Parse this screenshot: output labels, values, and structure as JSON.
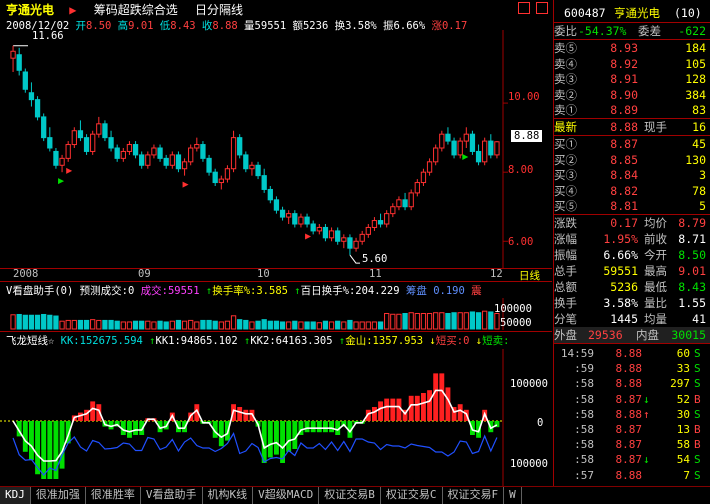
{
  "header": {
    "stock_name": "亨通光电",
    "menu": [
      "筹码超跌综合选",
      "日分隔线"
    ],
    "top_arrow": "▶"
  },
  "infoline": {
    "date": "2008/12/02",
    "open_label": "开",
    "open": "8.50",
    "high_label": "高",
    "high": "9.01",
    "low_label": "低",
    "low": "8.43",
    "close_label": "收",
    "close": "8.88",
    "vol_label": "量",
    "vol": "59551",
    "amt_label": "额",
    "amt": "5236",
    "turn_label": "换",
    "turn": "3.58%",
    "amp_label": "振",
    "amp": "6.66%",
    "chg_label": "涨",
    "chg": "0.17"
  },
  "price_chart": {
    "high_mark": "11.66",
    "low_mark": "5.60",
    "yticks": [
      "10.00",
      "8.00",
      "6.00"
    ],
    "current_price_tag": "8.88",
    "candles": [
      [
        11.3,
        11.66,
        10.9,
        11.5
      ],
      [
        11.4,
        11.6,
        10.8,
        10.95
      ],
      [
        10.9,
        11.0,
        10.3,
        10.4
      ],
      [
        10.3,
        10.6,
        9.9,
        10.1
      ],
      [
        10.1,
        10.2,
        9.5,
        9.6
      ],
      [
        9.6,
        9.7,
        8.9,
        9.0
      ],
      [
        9.0,
        9.3,
        8.6,
        8.7
      ],
      [
        8.6,
        8.7,
        8.1,
        8.2
      ],
      [
        8.2,
        8.5,
        8.0,
        8.4
      ],
      [
        8.4,
        8.9,
        8.3,
        8.8
      ],
      [
        8.8,
        9.3,
        8.7,
        9.2
      ],
      [
        9.2,
        9.5,
        8.9,
        9.0
      ],
      [
        9.0,
        9.1,
        8.5,
        8.6
      ],
      [
        8.6,
        9.2,
        8.5,
        9.1
      ],
      [
        9.1,
        9.6,
        9.0,
        9.4
      ],
      [
        9.4,
        9.5,
        8.9,
        9.0
      ],
      [
        9.0,
        9.2,
        8.6,
        8.7
      ],
      [
        8.7,
        8.8,
        8.3,
        8.4
      ],
      [
        8.4,
        8.7,
        8.3,
        8.6
      ],
      [
        8.6,
        8.9,
        8.5,
        8.8
      ],
      [
        8.8,
        8.9,
        8.4,
        8.5
      ],
      [
        8.5,
        8.6,
        8.1,
        8.2
      ],
      [
        8.2,
        8.6,
        8.1,
        8.5
      ],
      [
        8.5,
        8.8,
        8.4,
        8.7
      ],
      [
        8.7,
        8.8,
        8.3,
        8.4
      ],
      [
        8.4,
        8.5,
        8.1,
        8.2
      ],
      [
        8.2,
        8.6,
        8.1,
        8.5
      ],
      [
        8.5,
        8.6,
        8.0,
        8.1
      ],
      [
        8.1,
        8.4,
        7.9,
        8.3
      ],
      [
        8.3,
        8.8,
        8.2,
        8.7
      ],
      [
        8.7,
        9.0,
        8.6,
        8.8
      ],
      [
        8.8,
        8.9,
        8.3,
        8.4
      ],
      [
        8.4,
        8.5,
        7.9,
        8.0
      ],
      [
        8.0,
        8.1,
        7.6,
        7.7
      ],
      [
        7.7,
        7.9,
        7.5,
        7.8
      ],
      [
        7.8,
        8.2,
        7.7,
        8.1
      ],
      [
        8.1,
        9.2,
        8.0,
        9.0
      ],
      [
        9.0,
        9.1,
        8.4,
        8.5
      ],
      [
        8.5,
        8.6,
        8.0,
        8.1
      ],
      [
        8.1,
        8.3,
        7.9,
        8.2
      ],
      [
        8.2,
        8.3,
        7.8,
        7.9
      ],
      [
        7.9,
        8.1,
        7.4,
        7.5
      ],
      [
        7.5,
        7.6,
        7.1,
        7.2
      ],
      [
        7.2,
        7.3,
        6.8,
        6.9
      ],
      [
        6.9,
        7.0,
        6.6,
        6.7
      ],
      [
        6.7,
        6.9,
        6.5,
        6.8
      ],
      [
        6.8,
        6.9,
        6.4,
        6.5
      ],
      [
        6.5,
        6.8,
        6.4,
        6.7
      ],
      [
        6.7,
        6.8,
        6.4,
        6.5
      ],
      [
        6.5,
        6.6,
        6.2,
        6.3
      ],
      [
        6.3,
        6.5,
        6.2,
        6.4
      ],
      [
        6.4,
        6.5,
        6.0,
        6.1
      ],
      [
        6.1,
        6.4,
        6.0,
        6.3
      ],
      [
        6.3,
        6.4,
        5.9,
        6.0
      ],
      [
        6.0,
        6.2,
        5.8,
        6.1
      ],
      [
        6.1,
        6.2,
        5.6,
        5.8
      ],
      [
        5.8,
        6.1,
        5.7,
        6.0
      ],
      [
        6.0,
        6.3,
        5.9,
        6.2
      ],
      [
        6.2,
        6.5,
        6.1,
        6.4
      ],
      [
        6.4,
        6.7,
        6.3,
        6.6
      ],
      [
        6.6,
        6.8,
        6.4,
        6.5
      ],
      [
        6.5,
        6.9,
        6.4,
        6.8
      ],
      [
        6.8,
        7.1,
        6.7,
        7.0
      ],
      [
        7.0,
        7.3,
        6.9,
        7.2
      ],
      [
        7.2,
        7.4,
        6.9,
        7.0
      ],
      [
        7.0,
        7.5,
        6.9,
        7.4
      ],
      [
        7.4,
        7.8,
        7.3,
        7.7
      ],
      [
        7.7,
        8.1,
        7.6,
        8.0
      ],
      [
        8.0,
        8.4,
        7.9,
        8.3
      ],
      [
        8.3,
        8.8,
        8.2,
        8.7
      ],
      [
        8.7,
        9.2,
        8.6,
        9.1
      ],
      [
        9.1,
        9.3,
        8.8,
        8.9
      ],
      [
        8.9,
        9.0,
        8.4,
        8.5
      ],
      [
        8.5,
        9.0,
        8.4,
        8.9
      ],
      [
        8.9,
        9.3,
        8.7,
        9.1
      ],
      [
        9.1,
        9.2,
        8.5,
        8.6
      ],
      [
        8.6,
        8.8,
        8.2,
        8.3
      ],
      [
        8.3,
        9.0,
        8.2,
        8.9
      ],
      [
        8.9,
        9.1,
        8.4,
        8.5
      ],
      [
        8.5,
        8.9,
        8.4,
        8.88
      ]
    ],
    "buy_marks": [
      8,
      74
    ],
    "sell_marks": [
      9,
      28,
      48
    ]
  },
  "xaxis": [
    "2008",
    "09",
    "10",
    "11",
    "12"
  ],
  "xaxis_right": "日线",
  "vol_panel": {
    "title": "V看盘助手(0)",
    "predict_label": "预测成交:0",
    "cj_label": "成交:",
    "cj_value": "59551",
    "hsl_label": "换手率%:",
    "hsl_value": "3.585",
    "bhs_label": "百日换手%:",
    "bhs_value": "204.229",
    "cp_label": "筹盘",
    "cp_value": "0.190",
    "cp_tail": "震",
    "yticks": [
      "100000",
      "50000"
    ]
  },
  "fly_panel": {
    "title": "飞龙短线☆",
    "kk_label": "KK:",
    "kk_value": "152675.594",
    "kk1_label": "KK1:",
    "kk1_value": "94865.102",
    "kk2_label": "KK2:",
    "kk2_value": "64163.305",
    "js_label": "金山:",
    "js_value": "1357.953",
    "db_label": "短买:",
    "db_value": "0",
    "dm_label": "短卖:",
    "yticks": [
      "100000",
      "0",
      "100000"
    ]
  },
  "tabs": [
    "KDJ",
    "很准加强",
    "很准胜率",
    "V看盘助手",
    "机构K线",
    "V超级MACD",
    "权证交易B",
    "权证交易C",
    "权证交易F",
    "W"
  ],
  "right_panel": {
    "code": "600487",
    "name": "亨通光电",
    "num": "(10)",
    "wb_label": "委比",
    "wb_value": "-54.37%",
    "wc_label": "委差",
    "wc_value": "-622",
    "sells": [
      {
        "label": "卖⑤",
        "price": "8.93",
        "vol": "184"
      },
      {
        "label": "卖④",
        "price": "8.92",
        "vol": "105"
      },
      {
        "label": "卖③",
        "price": "8.91",
        "vol": "128"
      },
      {
        "label": "卖②",
        "price": "8.90",
        "vol": "384"
      },
      {
        "label": "卖①",
        "price": "8.89",
        "vol": "83"
      }
    ],
    "latest_label": "最新",
    "latest_value": "8.88",
    "xs_label": "现手",
    "xs_value": "16",
    "buys": [
      {
        "label": "买①",
        "price": "8.87",
        "vol": "45"
      },
      {
        "label": "买②",
        "price": "8.85",
        "vol": "130"
      },
      {
        "label": "买③",
        "price": "8.84",
        "vol": "3"
      },
      {
        "label": "买④",
        "price": "8.82",
        "vol": "78"
      },
      {
        "label": "买⑤",
        "price": "8.81",
        "vol": "5"
      }
    ],
    "stats": [
      {
        "l1": "涨跌",
        "v1": "0.17",
        "c1": "red",
        "l2": "均价",
        "v2": "8.79",
        "c2": "red"
      },
      {
        "l1": "涨幅",
        "v1": "1.95%",
        "c1": "red",
        "l2": "前收",
        "v2": "8.71",
        "c2": "white"
      },
      {
        "l1": "振幅",
        "v1": "6.66%",
        "c1": "white",
        "l2": "今开",
        "v2": "8.50",
        "c2": "green"
      },
      {
        "l1": "总手",
        "v1": "59551",
        "c1": "yellow",
        "l2": "最高",
        "v2": "9.01",
        "c2": "red"
      },
      {
        "l1": "总额",
        "v1": "5236",
        "c1": "yellow",
        "l2": "最低",
        "v2": "8.43",
        "c2": "green"
      },
      {
        "l1": "换手",
        "v1": "3.58%",
        "c1": "white",
        "l2": "量比",
        "v2": "1.55",
        "c2": "white"
      },
      {
        "l1": "分笔",
        "v1": "1445",
        "c1": "white",
        "l2": "均量",
        "v2": "41",
        "c2": "white"
      }
    ],
    "wp_label": "外盘",
    "wp_value": "29536",
    "np_label": "内盘",
    "np_value": "30015",
    "ticks": [
      {
        "time": "14:59",
        "price": "8.88",
        "arrow": "",
        "vol": "60",
        "bs": "S"
      },
      {
        "time": ":59",
        "price": "8.88",
        "arrow": "",
        "vol": "33",
        "bs": "S"
      },
      {
        "time": ":58",
        "price": "8.88",
        "arrow": "",
        "vol": "297",
        "bs": "S"
      },
      {
        "time": ":58",
        "price": "8.87",
        "arrow": "↓",
        "vol": "52",
        "bs": "B"
      },
      {
        "time": ":58",
        "price": "8.88",
        "arrow": "↑",
        "vol": "30",
        "bs": "S"
      },
      {
        "time": ":58",
        "price": "8.87",
        "arrow": "",
        "vol": "13",
        "bs": "B"
      },
      {
        "time": ":58",
        "price": "8.87",
        "arrow": "",
        "vol": "58",
        "bs": "B"
      },
      {
        "time": ":58",
        "price": "8.87",
        "arrow": "↓",
        "vol": "54",
        "bs": "S"
      },
      {
        "time": ":57",
        "price": "8.88",
        "arrow": "",
        "vol": "7",
        "bs": "S"
      }
    ]
  }
}
